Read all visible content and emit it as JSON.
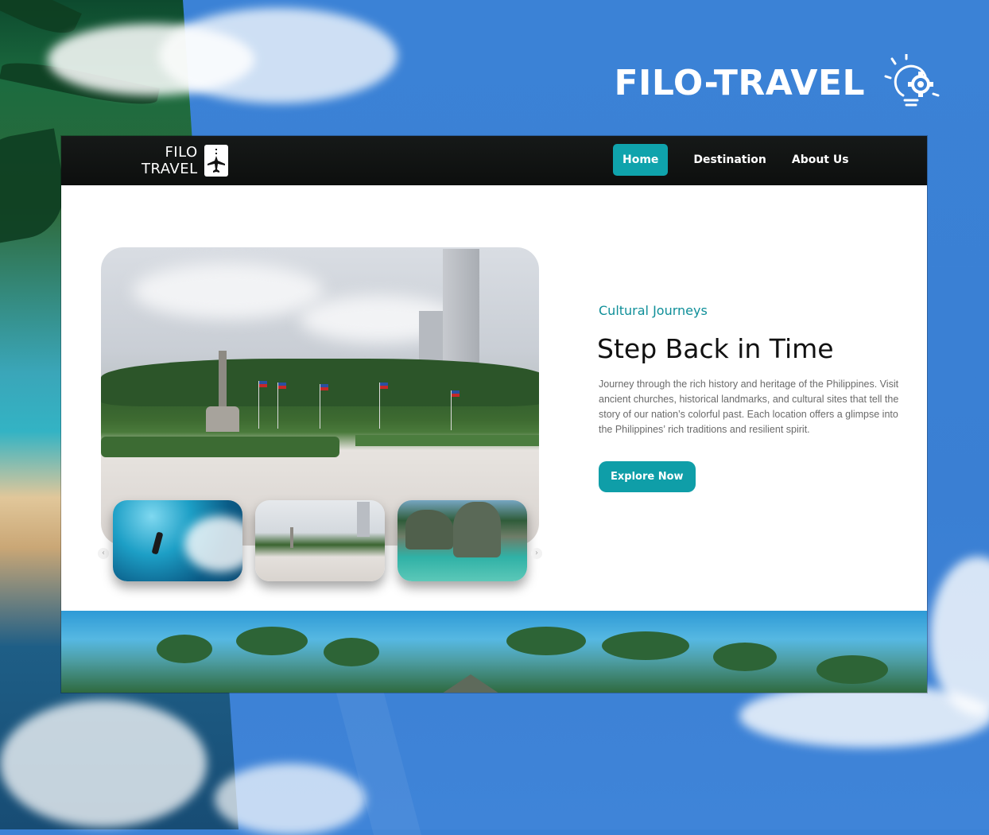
{
  "brand": {
    "title": "FILO-TRAVEL",
    "icon": "lightbulb-gear-icon"
  },
  "navbar": {
    "logo_line1": "FILO",
    "logo_line2": "TRAVEL",
    "logo_icon": "airplane-icon",
    "links": [
      {
        "label": "Home",
        "active": true
      },
      {
        "label": "Destination",
        "active": false
      },
      {
        "label": "About Us",
        "active": false
      }
    ]
  },
  "hero": {
    "eyebrow": "Cultural Journeys",
    "headline": "Step Back in Time",
    "description": "Journey through the rich history and heritage of the Philippines. Visit ancient churches, historical landmarks, and cultural sites that tell the story of our nation’s colorful past. Each location offers a glimpse into the Philippines’ rich traditions and resilient spirit.",
    "cta_label": "Explore Now",
    "carousel": {
      "prev_icon": "chevron-left-icon",
      "next_icon": "chevron-right-icon",
      "thumbnails": [
        {
          "name": "surfing-wave"
        },
        {
          "name": "park-monument"
        },
        {
          "name": "island-lagoon"
        }
      ]
    }
  },
  "colors": {
    "accent": "#0fa3ac",
    "eyebrow": "#0f8f99",
    "navbar_bg": "#121514",
    "page_bg": "#3b82d6"
  }
}
